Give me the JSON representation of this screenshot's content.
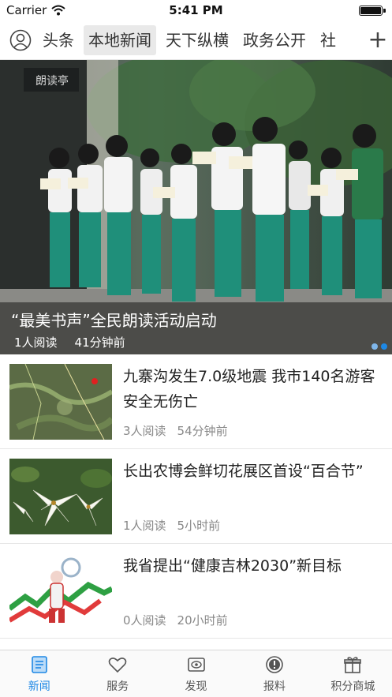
{
  "status_bar": {
    "carrier": "Carrier",
    "time": "5:41 PM"
  },
  "channels": [
    "头条",
    "本地新闻",
    "天下纵横",
    "政务公开",
    "社"
  ],
  "active_channel": 1,
  "hero": {
    "title": "“最美书声”全民朗读活动启动",
    "reads": "1人阅读",
    "time": "41分钟前",
    "sign_text": "朗读亭"
  },
  "news": [
    {
      "title": "九寨沟发生7.0级地震 我市140名游客安全无伤亡",
      "reads": "3人阅读",
      "time": "54分钟前"
    },
    {
      "title": "长出农博会鲜切花展区首设“百合节”",
      "reads": "1人阅读",
      "time": "5小时前"
    },
    {
      "title": "我省提出“健康吉林2030”新目标",
      "reads": "0人阅读",
      "time": "20小时前"
    }
  ],
  "tab_bar": [
    {
      "label": "新闻",
      "icon": "news-icon"
    },
    {
      "label": "服务",
      "icon": "heart-icon"
    },
    {
      "label": "发现",
      "icon": "eye-icon"
    },
    {
      "label": "报料",
      "icon": "alert-icon"
    },
    {
      "label": "积分商城",
      "icon": "gift-icon"
    }
  ],
  "colors": {
    "accent": "#1e88e5",
    "uniform_green": "#1f8f7a"
  }
}
